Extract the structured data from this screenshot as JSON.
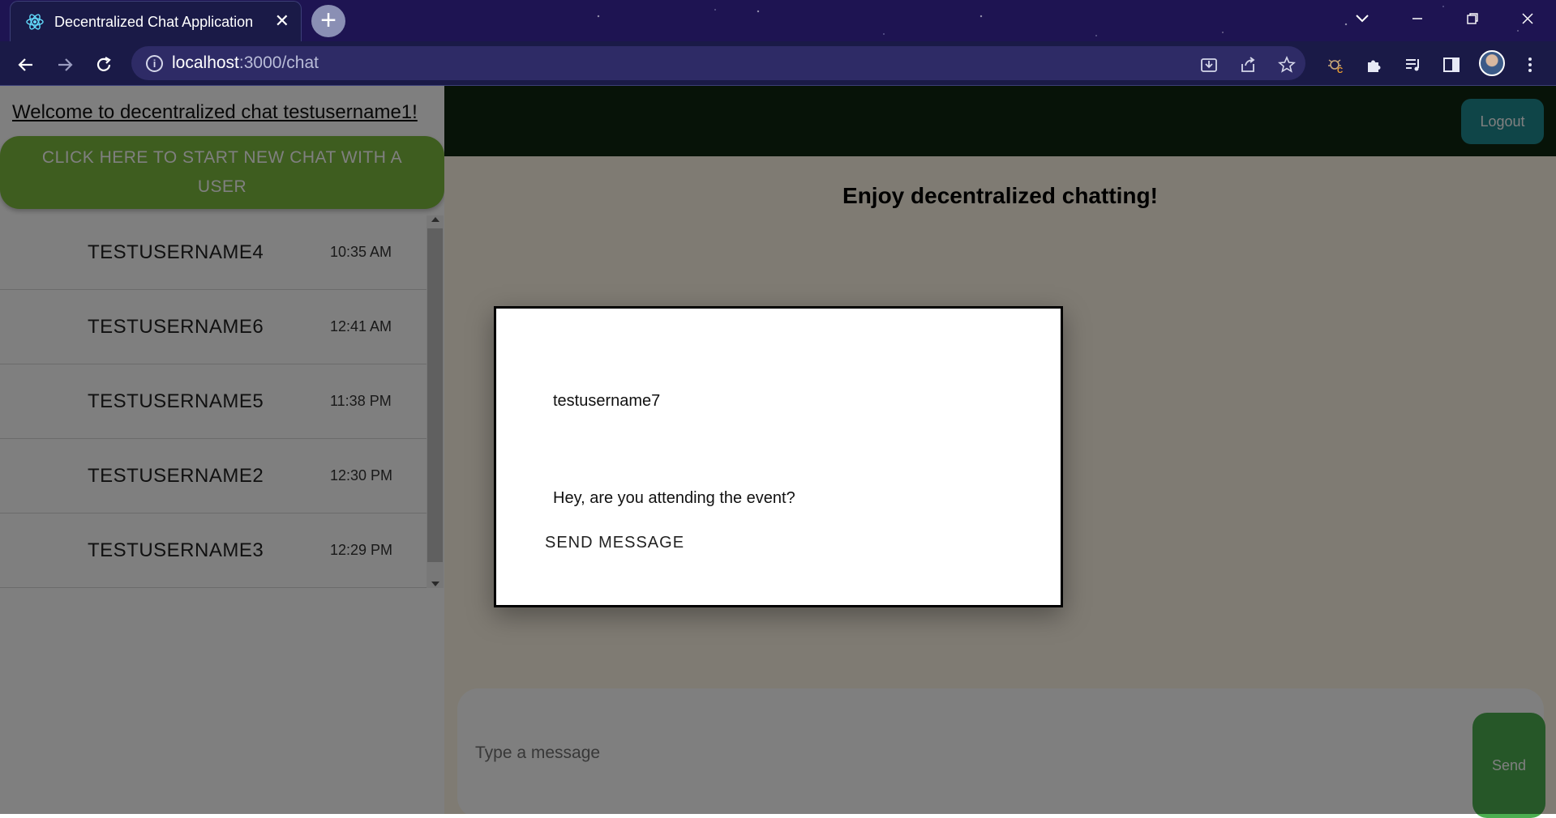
{
  "browser": {
    "tab_title": "Decentralized Chat Application",
    "tab_close_symbol": "✕",
    "new_tab_symbol": "+",
    "url_host": "localhost",
    "url_path": ":3000/chat"
  },
  "sidebar": {
    "welcome_text": "Welcome to decentralized chat testusername1!",
    "new_chat_button": "CLICK HERE TO START NEW CHAT WITH A USER",
    "chats": [
      {
        "name": "TESTUSERNAME4",
        "time": "10:35 AM"
      },
      {
        "name": "TESTUSERNAME6",
        "time": "12:41 AM"
      },
      {
        "name": "TESTUSERNAME5",
        "time": "11:38 PM"
      },
      {
        "name": "TESTUSERNAME2",
        "time": "12:30 PM"
      },
      {
        "name": "TESTUSERNAME3",
        "time": "12:29 PM"
      }
    ]
  },
  "main": {
    "logout_label": "Logout",
    "heading": "Enjoy decentralized chatting!",
    "message_placeholder": "Type a message",
    "send_label": "Send"
  },
  "modal": {
    "recipient_value": "testusername7",
    "message_value": "Hey, are you attending the event?",
    "send_label": "SEND MESSAGE"
  },
  "colors": {
    "topbar": "#0e2710",
    "new_chat_button": "#7dbb3e",
    "logout_button": "#1e8a90",
    "send_button": "#4cae50"
  }
}
